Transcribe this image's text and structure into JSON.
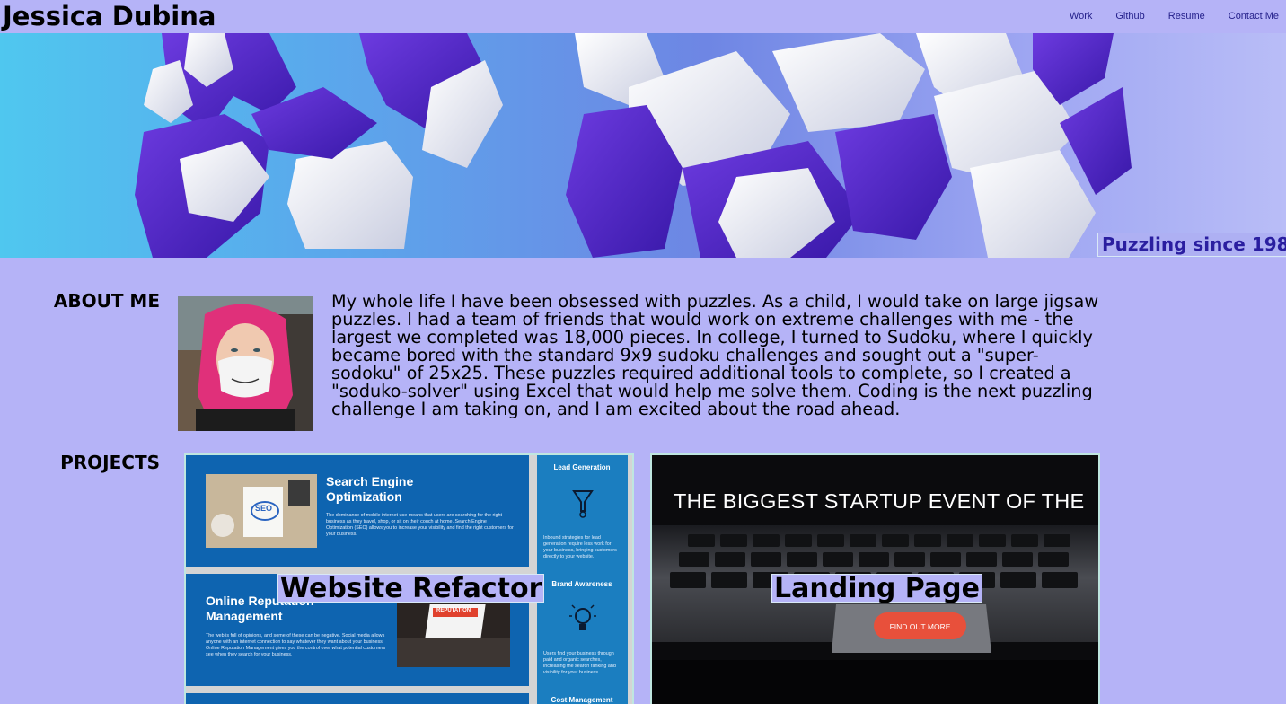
{
  "header": {
    "site_title": "Jessica Dubina",
    "nav": [
      "Work",
      "Github",
      "Resume",
      "Contact Me"
    ]
  },
  "hero": {
    "tagline": "Puzzling since 198"
  },
  "about": {
    "heading": "ABOUT ME",
    "text": "My whole life I have been obsessed with puzzles. As a child, I would take on large jigsaw puzzles. I had a team of friends that would work on extreme challenges with me - the largest we completed was 18,000 pieces. In college, I turned to Sudoku, where I quickly became bored with the standard 9x9 sudoku challenges and sought out a \"super-sodoku\" of 25x25. These puzzles required additional tools to complete, so I created a \"soduko-solver\" using Excel that would help me solve them. Coding is the next puzzling challenge I am taking on, and I am excited about the road ahead."
  },
  "projects": {
    "heading": "PROJECTS",
    "items": [
      {
        "label": "Website Refactor",
        "screenshot": {
          "seo_title": "Search Engine Optimization",
          "seo_body": "The dominance of mobile internet use means that users are searching for the right business as they travel, shop, or sit on their couch at home. Search Engine Optimization (SEO) allows you to increase your visibility and find the right customers for your business.",
          "orm_title": "Online Reputation Management",
          "orm_body": "The web is full of opinions, and some of these can be negative. Social media allows anyone with an internet connection to say whatever they want about your business. Online Reputation Management gives you the control over what potential customers see when they search for your business.",
          "side_1": "Lead Generation",
          "side_1_body": "Inbound strategies for lead generation require less work for your business, bringing customers directly to your website.",
          "side_2": "Brand Awareness",
          "side_2_body": "Users find your business through paid and organic searches, increasing the search ranking and visibility for your business.",
          "side_3": "Cost Management",
          "seo_note": "SEO",
          "orm_note": "REPUTATION"
        }
      },
      {
        "label": "Landing Page",
        "screenshot": {
          "headline": "THE BIGGEST STARTUP EVENT OF THE",
          "button": "FIND OUT MORE"
        }
      }
    ]
  },
  "colors": {
    "page_bg": "#b5b3f7",
    "nav_link": "#231f8a",
    "tagline_text": "#2a1ea0",
    "seo_blue": "#0e64b0",
    "cta": "#e8503b"
  },
  "icons": [
    "funnel-icon",
    "lightbulb-icon"
  ]
}
